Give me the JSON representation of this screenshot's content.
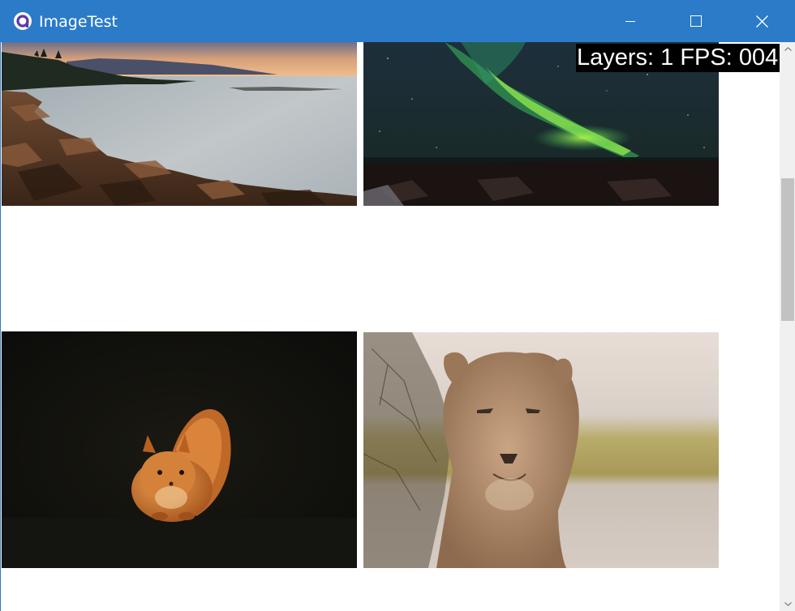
{
  "window": {
    "title": "ImageTest",
    "controls": {
      "minimize": "minimize-icon",
      "maximize": "maximize-icon",
      "close": "close-icon"
    },
    "accent_color": "#2b7bc8"
  },
  "overlay": {
    "text": "Layers: 1 FPS: 004"
  },
  "images": [
    {
      "subject": "coastal sunset with rocks"
    },
    {
      "subject": "aurora borealis over landscape"
    },
    {
      "subject": "red squirrel on dark background"
    },
    {
      "subject": "lioness portrait"
    }
  ],
  "scrollbar": {
    "orientation": "vertical",
    "up_icon": "chevron-up-icon",
    "down_icon": "chevron-down-icon"
  }
}
